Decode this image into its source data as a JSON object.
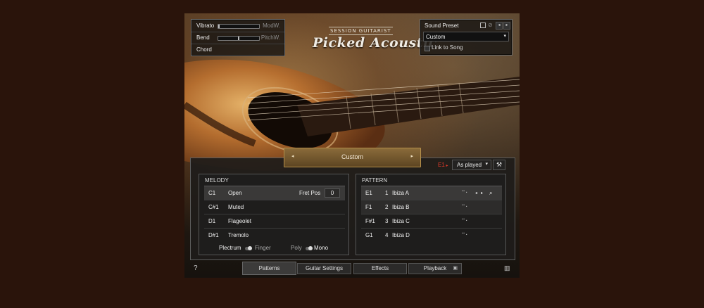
{
  "controls": {
    "vibrato": {
      "label": "Vibrato",
      "source": "ModW.",
      "level": 0.0
    },
    "bend": {
      "label": "Bend",
      "source": "PitchW.",
      "level": 0.5
    },
    "chord": {
      "label": "Chord"
    }
  },
  "logo": {
    "line1": "SESSION GUITARIST",
    "line2": "Picked Acoustic"
  },
  "preset": {
    "title": "Sound Preset",
    "value": "Custom",
    "link_label": "Link to Song"
  },
  "center_bar": {
    "label": "Custom"
  },
  "pattern_controls": {
    "key": "E1",
    "mode": "As played"
  },
  "melody": {
    "header": "MELODY",
    "fret_pos_label": "Fret Pos",
    "fret_pos_value": "0",
    "rows": [
      {
        "key": "C1",
        "name": "Open"
      },
      {
        "key": "C#1",
        "name": "Muted"
      },
      {
        "key": "D1",
        "name": "Flageolet"
      },
      {
        "key": "D#1",
        "name": "Tremolo"
      }
    ],
    "toggle1": {
      "left": "Plectrum",
      "right": "Finger"
    },
    "toggle2": {
      "left": "Poly",
      "right": "Mono"
    }
  },
  "pattern": {
    "header": "PATTERN",
    "rows": [
      {
        "key": "E1",
        "num": "1",
        "name": "Ibiza A"
      },
      {
        "key": "F1",
        "num": "2",
        "name": "Ibiza B"
      },
      {
        "key": "F#1",
        "num": "3",
        "name": "Ibiza C"
      },
      {
        "key": "G1",
        "num": "4",
        "name": "Ibiza D"
      }
    ]
  },
  "tabs": [
    "Patterns",
    "Guitar Settings",
    "Effects",
    "Playback"
  ],
  "help": "?"
}
